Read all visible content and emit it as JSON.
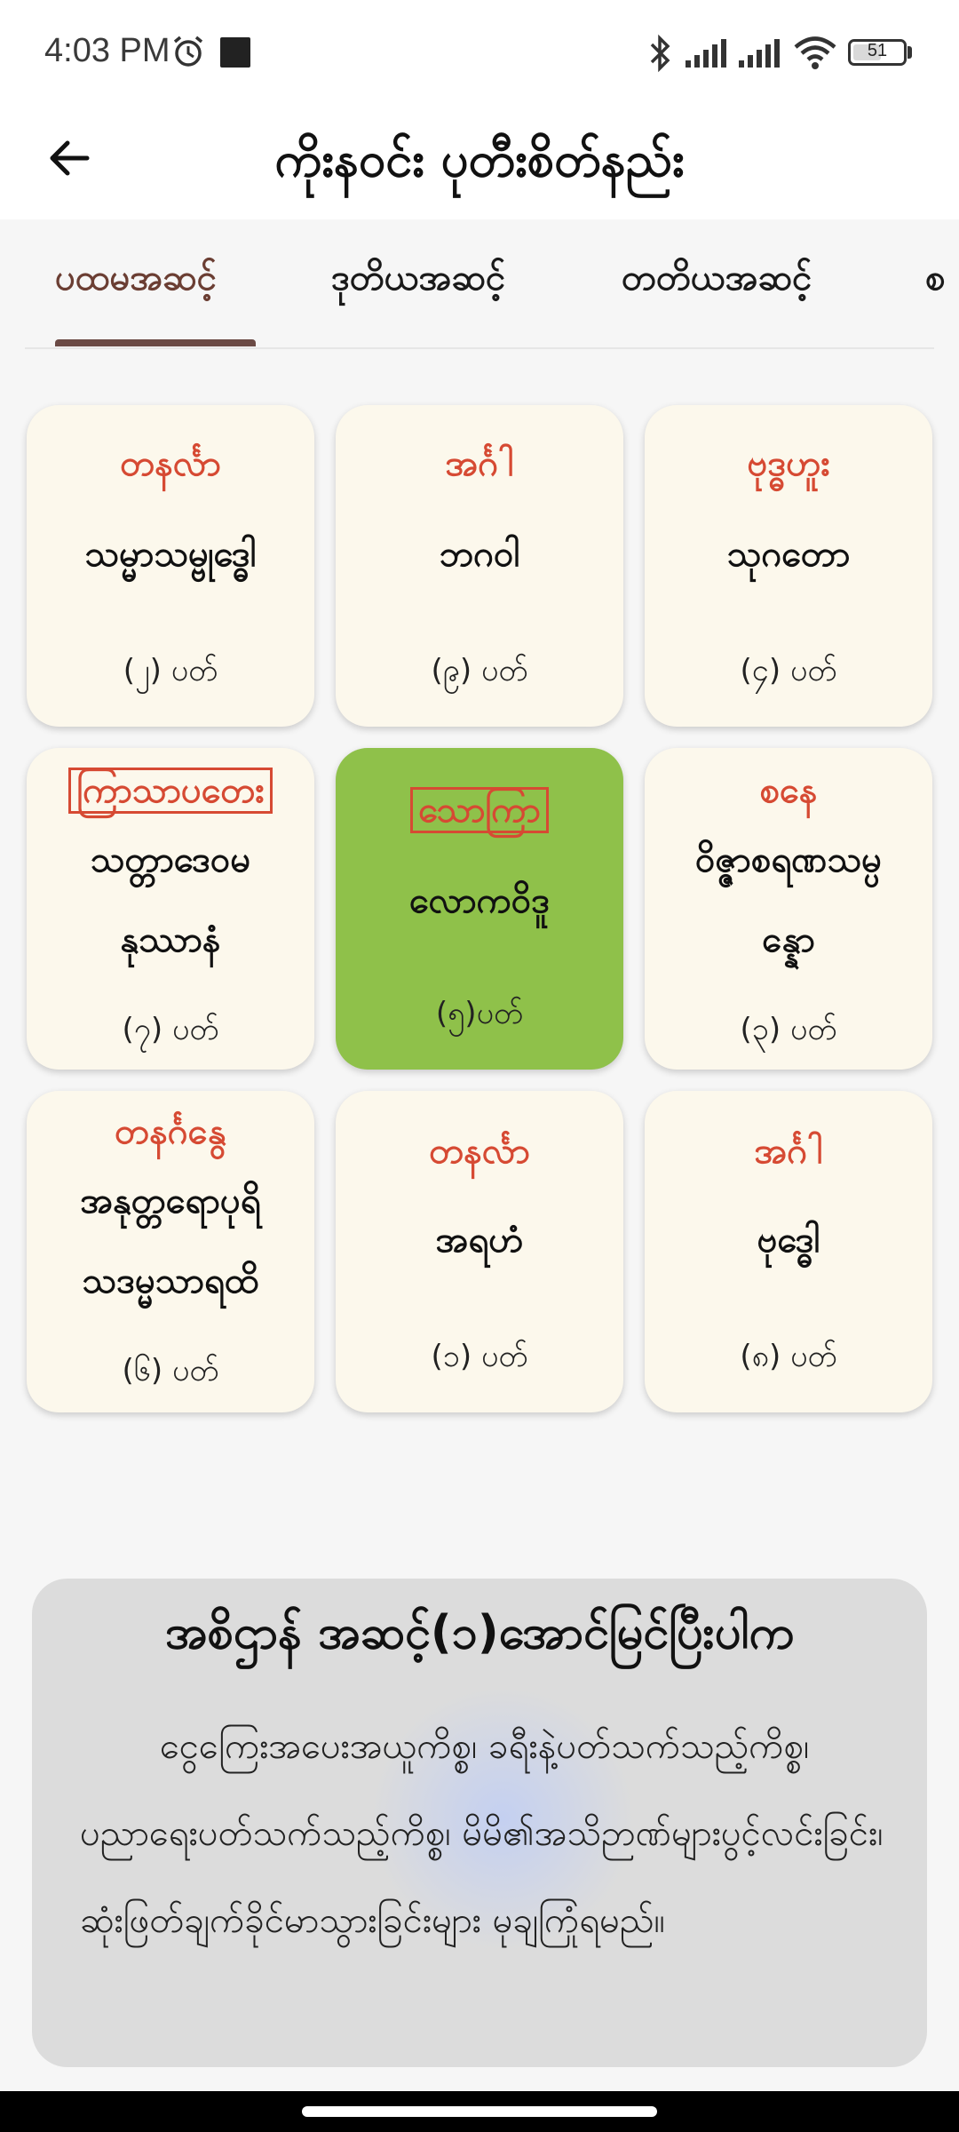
{
  "status_bar": {
    "time": "4:03 PM",
    "battery_level": "51",
    "icons": [
      "alarm-icon",
      "notification-square-icon",
      "bluetooth-icon",
      "signal-icon",
      "signal-icon",
      "wifi-icon",
      "battery-icon"
    ]
  },
  "app_bar": {
    "title": "ကိုးနဝင်း ပုတီးစိတ်နည်း",
    "back_icon": "arrow-left-icon"
  },
  "tabs": [
    {
      "label": "ပထမအဆင့်",
      "active": true
    },
    {
      "label": "ဒုတိယအဆင့်",
      "active": false
    },
    {
      "label": "တတိယအဆင့်",
      "active": false
    },
    {
      "label": "စ",
      "active": false
    }
  ],
  "cards": [
    {
      "day": "တနင်္လာ",
      "name": "သမ္မာသမ္ဗုဒ္ဓေါ",
      "count": "(၂) ပတ်"
    },
    {
      "day": "အင်္ဂါ",
      "name": "ဘဂဝါ",
      "count": "(၉) ပတ်"
    },
    {
      "day": "ဗုဒ္ဓဟူး",
      "name": "သုဂတော",
      "count": "(၄) ပတ်"
    },
    {
      "day": "ကြာသာပတေး",
      "name_line1": "သတ္တာဒေဝမ",
      "name_line2": "နုဿာနံ",
      "count": "(၇) ပတ်"
    },
    {
      "day": "သောကြာ",
      "name": "လောကဝိဒူ",
      "count": "(၅)ပတ်",
      "selected": true
    },
    {
      "day": "စနေ",
      "name_line1": "ဝိဇ္ဇာစရဏသမ္ပ",
      "name_line2": "န္နော",
      "count": "(၃) ပတ်"
    },
    {
      "day": "တနင်္ဂနွေ",
      "name_line1": "အနုတ္တရောပုရိ",
      "name_line2": "သဒမ္မသာရထိ",
      "count": "(၆) ပတ်"
    },
    {
      "day": "တနင်္လာ",
      "name": "အရဟံ",
      "count": "(၁) ပတ်"
    },
    {
      "day": "အင်္ဂါ",
      "name": "ဗုဒ္ဓေါ",
      "count": "(၈) ပတ်"
    }
  ],
  "colors": {
    "accent": "#d64a33",
    "selected_card": "#8fc14a",
    "card_bg": "#fcf8ec",
    "tab_active": "#6b3e33"
  },
  "info": {
    "title": "အစိဌာန် အဆင့်(၁)အောင်မြင်ပြီးပါက",
    "body": "ငွေကြေးအပေးအယူကိစ္စ၊ ခရီးနဲ့ပတ်သက်သည့်ကိစ္စ၊ ပညာရေးပတ်သက်သည့်ကိစ္စ၊ မိမိ၏အသိဉာဏ်များပွင့်လင်းခြင်း၊ ဆုံးဖြတ်ချက်ခိုင်မာသွားခြင်းများ မုချကြုံရမည်။"
  }
}
